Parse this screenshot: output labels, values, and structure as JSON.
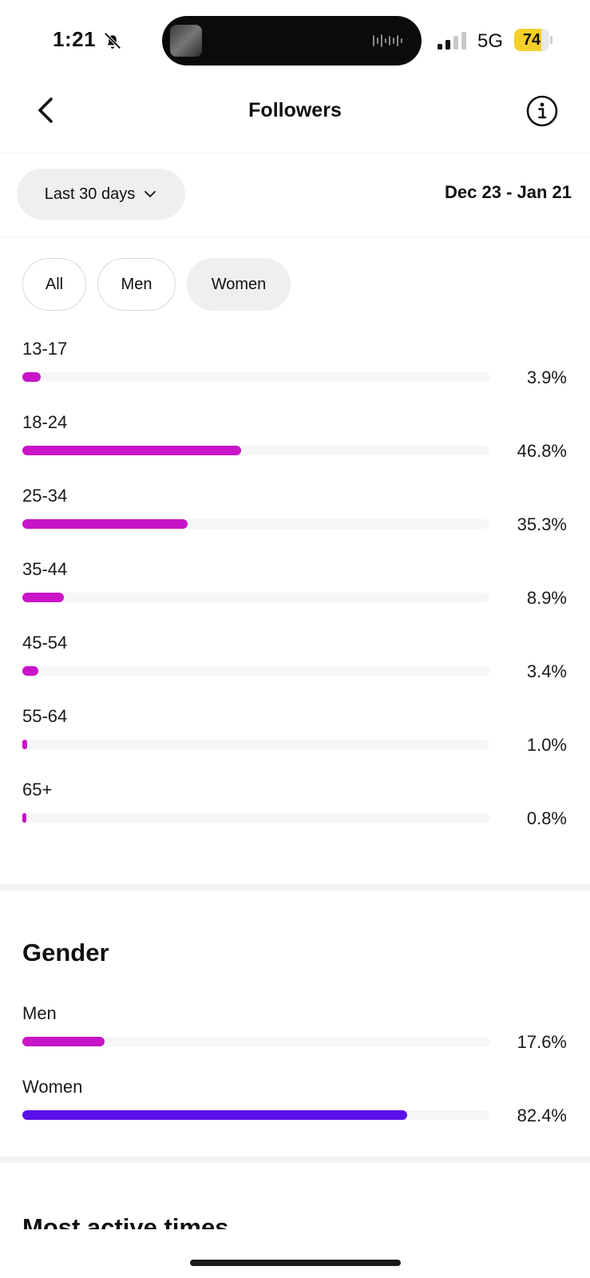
{
  "status_bar": {
    "time": "1:21",
    "network": "5G",
    "battery": "74",
    "icons": [
      "bell-off-icon",
      "signal-icon",
      "battery-icon"
    ]
  },
  "header": {
    "title": "Followers",
    "back_icon": "chevron-left-icon",
    "info_icon": "info-icon"
  },
  "date_filter": {
    "range_label": "Last 30 days",
    "range_icon": "chevron-down-icon",
    "date_range": "Dec 23 - Jan 21"
  },
  "chips": {
    "all": "All",
    "men": "Men",
    "women": "Women",
    "selected": "Women"
  },
  "age_ranges": [
    {
      "label": "13-17",
      "value": "3.9%",
      "fill": 3.9
    },
    {
      "label": "18-24",
      "value": "46.8%",
      "fill": 46.8
    },
    {
      "label": "25-34",
      "value": "35.3%",
      "fill": 35.3
    },
    {
      "label": "35-44",
      "value": "8.9%",
      "fill": 8.9
    },
    {
      "label": "45-54",
      "value": "3.4%",
      "fill": 3.4
    },
    {
      "label": "55-64",
      "value": "1.0%",
      "fill": 1.0
    },
    {
      "label": "65+",
      "value": "0.8%",
      "fill": 0.8
    }
  ],
  "gender": {
    "title": "Gender",
    "items": [
      {
        "label": "Men",
        "value": "17.6%",
        "fill": 17.6,
        "color": "#c815c7"
      },
      {
        "label": "Women",
        "value": "82.4%",
        "fill": 82.4,
        "color": "#5a10e8"
      }
    ]
  },
  "most_active": {
    "title": "Most active times"
  },
  "colors": {
    "accent_magenta": "#c815c7",
    "accent_purple": "#5a10e8",
    "battery_yellow": "#f5cf2a"
  }
}
